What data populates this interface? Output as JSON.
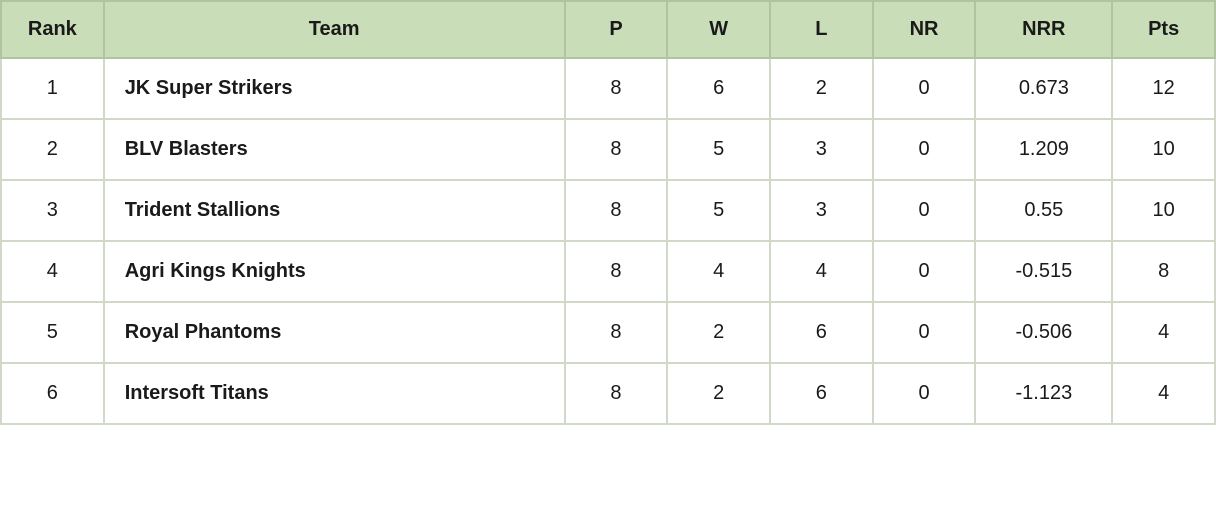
{
  "header": {
    "rank": "Rank",
    "team": "Team",
    "p": "P",
    "w": "W",
    "l": "L",
    "nr": "NR",
    "nrr": "NRR",
    "pts": "Pts"
  },
  "rows": [
    {
      "rank": "1",
      "team": "JK Super Strikers",
      "p": "8",
      "w": "6",
      "l": "2",
      "nr": "0",
      "nrr": "0.673",
      "pts": "12"
    },
    {
      "rank": "2",
      "team": "BLV Blasters",
      "p": "8",
      "w": "5",
      "l": "3",
      "nr": "0",
      "nrr": "1.209",
      "pts": "10"
    },
    {
      "rank": "3",
      "team": "Trident Stallions",
      "p": "8",
      "w": "5",
      "l": "3",
      "nr": "0",
      "nrr": "0.55",
      "pts": "10"
    },
    {
      "rank": "4",
      "team": "Agri Kings Knights",
      "p": "8",
      "w": "4",
      "l": "4",
      "nr": "0",
      "nrr": "-0.515",
      "pts": "8"
    },
    {
      "rank": "5",
      "team": "Royal Phantoms",
      "p": "8",
      "w": "2",
      "l": "6",
      "nr": "0",
      "nrr": "-0.506",
      "pts": "4"
    },
    {
      "rank": "6",
      "team": "Intersoft Titans",
      "p": "8",
      "w": "2",
      "l": "6",
      "nr": "0",
      "nrr": "-1.123",
      "pts": "4"
    }
  ]
}
